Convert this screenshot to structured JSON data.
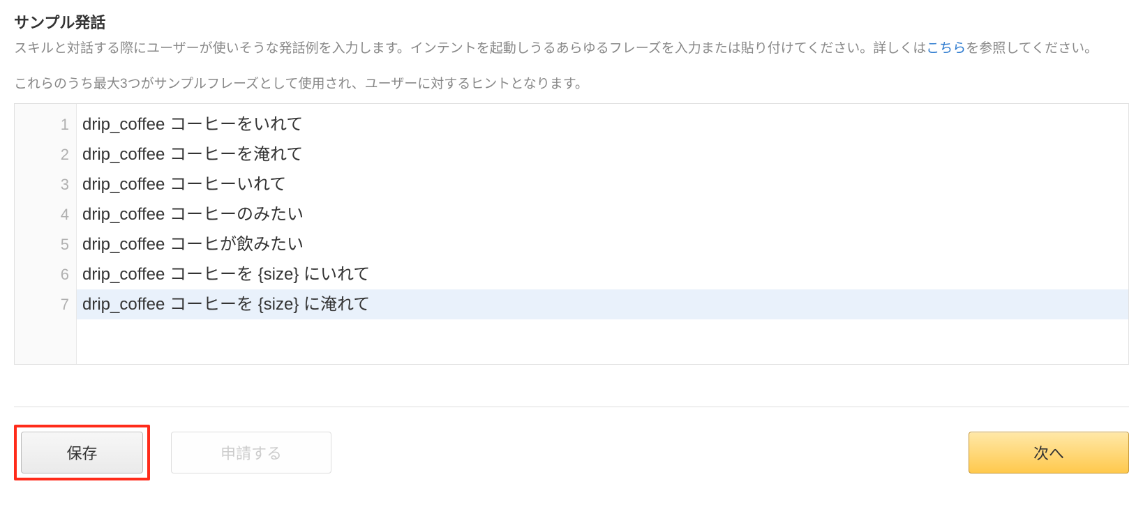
{
  "section": {
    "title": "サンプル発話",
    "description_before": "スキルと対話する際にユーザーが使いそうな発話例を入力します。インテントを起動しうるあらゆるフレーズを入力または貼り付けてください。詳しくは",
    "description_link": "こちら",
    "description_after": "を参照してください。",
    "hint": "これらのうち最大3つがサンプルフレーズとして使用され、ユーザーに対するヒントとなります。"
  },
  "editor": {
    "lines": [
      {
        "num": "1",
        "text": "drip_coffee コーヒーをいれて",
        "selected": false
      },
      {
        "num": "2",
        "text": "drip_coffee コーヒーを淹れて",
        "selected": false
      },
      {
        "num": "3",
        "text": "drip_coffee コーヒーいれて",
        "selected": false
      },
      {
        "num": "4",
        "text": "drip_coffee コーヒーのみたい",
        "selected": false
      },
      {
        "num": "5",
        "text": "drip_coffee コーヒが飲みたい",
        "selected": false
      },
      {
        "num": "6",
        "text": "drip_coffee コーヒーを {size} にいれて",
        "selected": false
      },
      {
        "num": "7",
        "text": "drip_coffee コーヒーを {size} に淹れて",
        "selected": true
      }
    ]
  },
  "buttons": {
    "save": "保存",
    "submit": "申請する",
    "next": "次へ"
  }
}
